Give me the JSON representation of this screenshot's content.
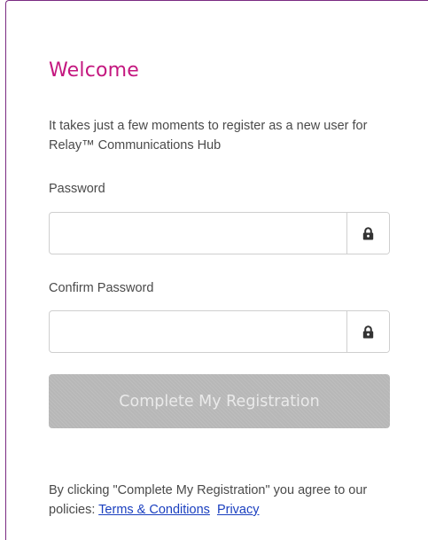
{
  "form": {
    "title": "Welcome",
    "intro": "It takes just a few moments to register as a new user for Relay™ Communications Hub",
    "password_label": "Password",
    "password_value": "",
    "confirm_label": "Confirm Password",
    "confirm_value": "",
    "submit_label": "Complete My Registration",
    "policy_text": "By clicking \"Complete My Registration\" you agree to our policies:",
    "terms_link": "Terms & Conditions",
    "privacy_link": "Privacy"
  },
  "icons": {
    "password_addon": "lock-icon",
    "confirm_addon": "lock-icon"
  },
  "colors": {
    "title": "#c4177f",
    "card_border": "#7a2a82",
    "button_disabled": "#b7b7b7",
    "link": "#1a3fbf"
  }
}
